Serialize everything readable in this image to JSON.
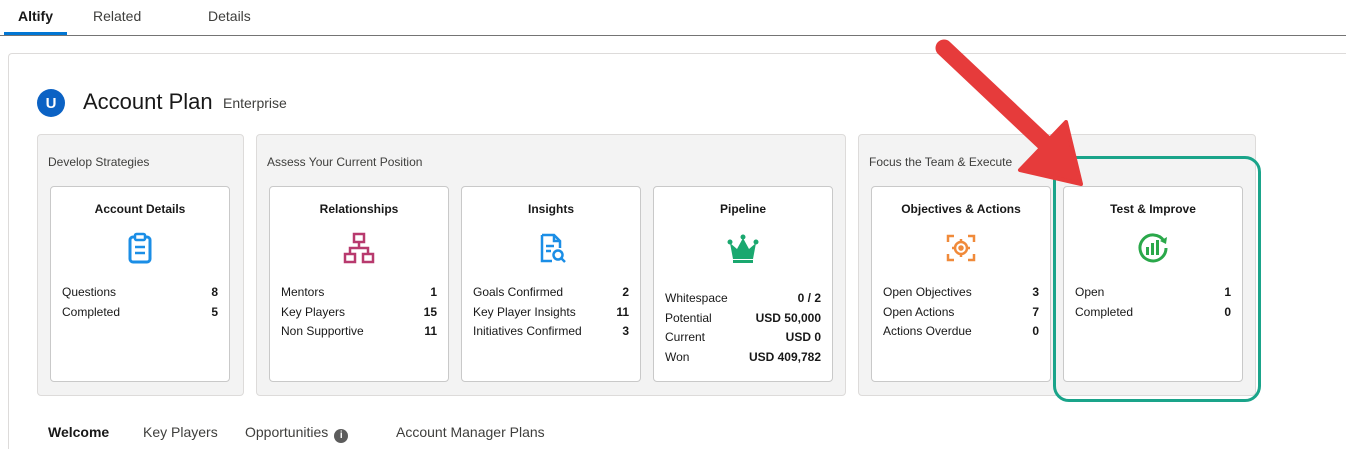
{
  "top_tabs": [
    "Altify",
    "Related",
    "Details"
  ],
  "header": {
    "logo_letter": "U",
    "title": "Account Plan",
    "subtitle": "Enterprise"
  },
  "groups": [
    {
      "label": "Develop Strategies"
    },
    {
      "label": "Assess Your Current Position"
    },
    {
      "label": "Focus the Team & Execute"
    }
  ],
  "tiles": {
    "account_details": {
      "title": "Account Details",
      "icon": "clipboard-icon",
      "stats": [
        {
          "label": "Questions",
          "value": "8"
        },
        {
          "label": "Completed",
          "value": "5"
        }
      ]
    },
    "relationships": {
      "title": "Relationships",
      "icon": "org-chart-icon",
      "stats": [
        {
          "label": "Mentors",
          "value": "1"
        },
        {
          "label": "Key Players",
          "value": "15"
        },
        {
          "label": "Non Supportive",
          "value": "11"
        }
      ]
    },
    "insights": {
      "title": "Insights",
      "icon": "document-search-icon",
      "stats": [
        {
          "label": "Goals Confirmed",
          "value": "2"
        },
        {
          "label": "Key Player Insights",
          "value": "11"
        },
        {
          "label": "Initiatives Confirmed",
          "value": "3"
        }
      ]
    },
    "pipeline": {
      "title": "Pipeline",
      "icon": "crown-icon",
      "stats": [
        {
          "label": "Whitespace",
          "value": "0 / 2"
        },
        {
          "label": "Potential",
          "value": "USD 50,000"
        },
        {
          "label": "Current",
          "value": "USD 0"
        },
        {
          "label": "Won",
          "value": "USD 409,782"
        }
      ]
    },
    "objectives": {
      "title": "Objectives & Actions",
      "icon": "target-icon",
      "stats": [
        {
          "label": "Open Objectives",
          "value": "3"
        },
        {
          "label": "Open Actions",
          "value": "7"
        },
        {
          "label": "Actions Overdue",
          "value": "0"
        }
      ]
    },
    "test_improve": {
      "title": "Test & Improve",
      "icon": "growth-chart-icon",
      "stats": [
        {
          "label": "Open",
          "value": "1"
        },
        {
          "label": "Completed",
          "value": "0"
        }
      ]
    }
  },
  "bottom_tabs": [
    "Welcome",
    "Key Players",
    "Opportunities",
    "Account Manager Plans"
  ],
  "colors": {
    "accent": "#0176d3",
    "highlight": "#1aa48a",
    "arrow": "#e63b3b",
    "clipboard": "#1b8ee6",
    "org": "#b83a6e",
    "crown": "#1aa86f",
    "target": "#f08a3a",
    "growth": "#2aa84a"
  }
}
